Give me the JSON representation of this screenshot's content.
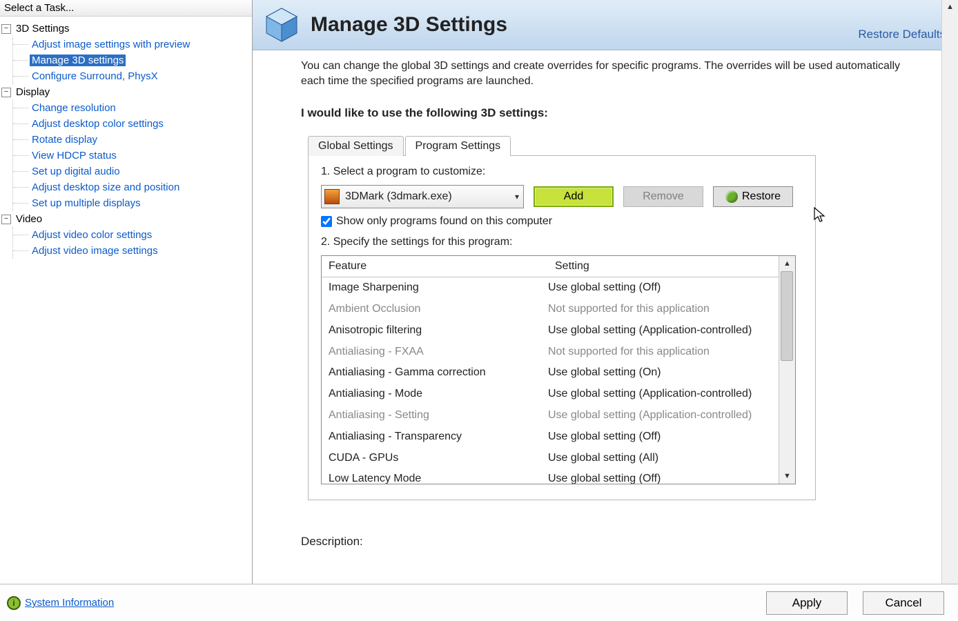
{
  "sidebar": {
    "title": "Select a Task...",
    "groups": [
      {
        "label": "3D Settings",
        "items": [
          "Adjust image settings with preview",
          "Manage 3D settings",
          "Configure Surround, PhysX"
        ],
        "selectedIndex": 1
      },
      {
        "label": "Display",
        "items": [
          "Change resolution",
          "Adjust desktop color settings",
          "Rotate display",
          "View HDCP status",
          "Set up digital audio",
          "Adjust desktop size and position",
          "Set up multiple displays"
        ],
        "selectedIndex": -1
      },
      {
        "label": "Video",
        "items": [
          "Adjust video color settings",
          "Adjust video image settings"
        ],
        "selectedIndex": -1
      }
    ]
  },
  "header": {
    "title": "Manage 3D Settings",
    "restore_defaults": "Restore Defaults"
  },
  "intro": "You can change the global 3D settings and create overrides for specific programs. The overrides will be used automatically each time the specified programs are launched.",
  "section_title": "I would like to use the following 3D settings:",
  "tabs": {
    "global": "Global Settings",
    "program": "Program Settings",
    "active": "program"
  },
  "step1_label": "1. Select a program to customize:",
  "program_combo": {
    "selected": "3DMark (3dmark.exe)"
  },
  "buttons": {
    "add": "Add",
    "remove": "Remove",
    "restore": "Restore"
  },
  "show_only_label": "Show only programs found on this computer",
  "show_only_checked": true,
  "step2_label": "2. Specify the settings for this program:",
  "table": {
    "col_feature": "Feature",
    "col_setting": "Setting",
    "rows": [
      {
        "f": "Image Sharpening",
        "s": "Use global setting (Off)",
        "disabled": false
      },
      {
        "f": "Ambient Occlusion",
        "s": "Not supported for this application",
        "disabled": true
      },
      {
        "f": "Anisotropic filtering",
        "s": "Use global setting (Application-controlled)",
        "disabled": false
      },
      {
        "f": "Antialiasing - FXAA",
        "s": "Not supported for this application",
        "disabled": true
      },
      {
        "f": "Antialiasing - Gamma correction",
        "s": "Use global setting (On)",
        "disabled": false
      },
      {
        "f": "Antialiasing - Mode",
        "s": "Use global setting (Application-controlled)",
        "disabled": false
      },
      {
        "f": "Antialiasing - Setting",
        "s": "Use global setting (Application-controlled)",
        "disabled": true
      },
      {
        "f": "Antialiasing - Transparency",
        "s": "Use global setting (Off)",
        "disabled": false
      },
      {
        "f": "CUDA - GPUs",
        "s": "Use global setting (All)",
        "disabled": false
      },
      {
        "f": "Low Latency Mode",
        "s": "Use global setting (Off)",
        "disabled": false
      }
    ]
  },
  "description_label": "Description:",
  "footer": {
    "sysinfo": "System Information",
    "apply": "Apply",
    "cancel": "Cancel"
  }
}
